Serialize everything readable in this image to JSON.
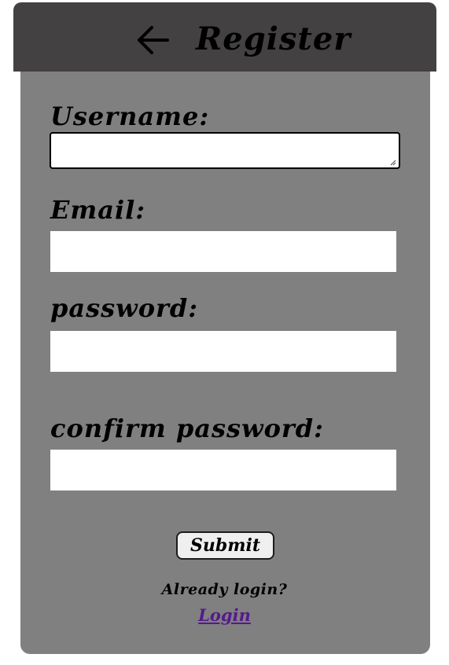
{
  "header": {
    "title": "Register",
    "back_icon": "arrow-left-icon"
  },
  "form": {
    "username_label": "Username:",
    "username_value": "",
    "email_label": "Email:",
    "email_value": "",
    "password_label": "password:",
    "password_value": "",
    "confirm_label": "confirm password:",
    "confirm_value": "",
    "submit_label": "Submit"
  },
  "footer": {
    "prompt": "Already login?",
    "login_link": "Login"
  },
  "colors": {
    "header_bg": "#434142",
    "card_bg": "#808080",
    "link": "#551a8b"
  }
}
